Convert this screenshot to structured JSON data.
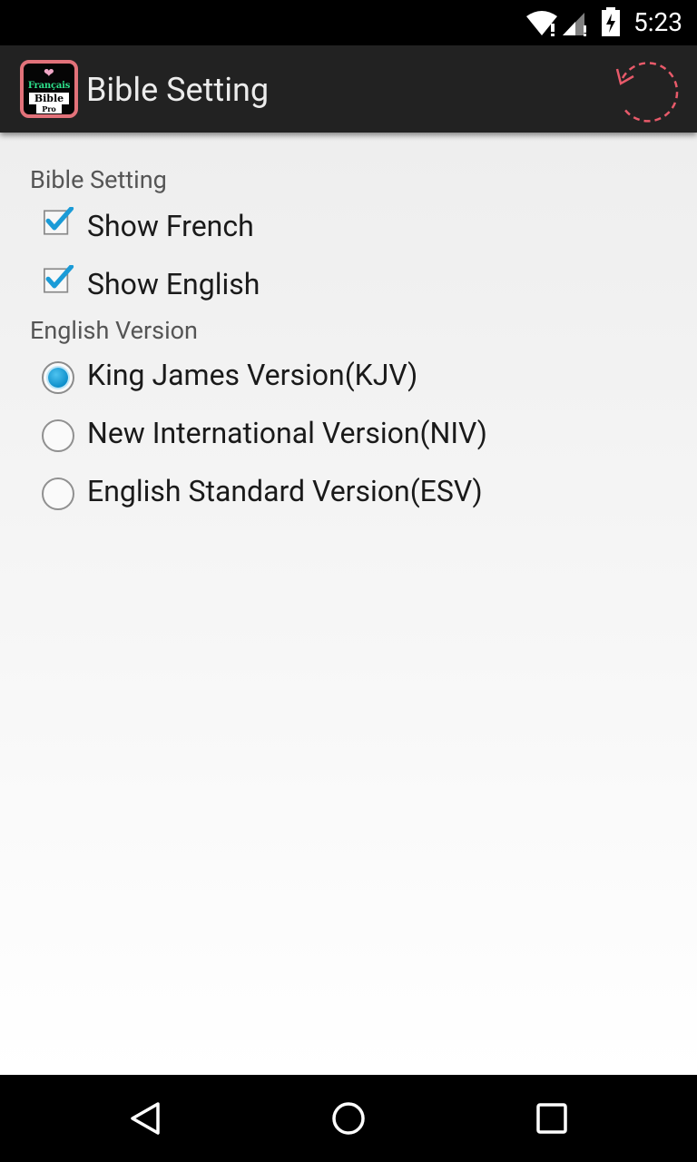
{
  "status_bar": {
    "time": "5:23"
  },
  "action_bar": {
    "title": "Bible Setting",
    "app_icon": {
      "line1": "Français",
      "line2": "Bible",
      "line3": "Pro"
    }
  },
  "sections": {
    "bible_setting": {
      "header": "Bible Setting",
      "show_french": {
        "label": "Show French",
        "checked": true
      },
      "show_english": {
        "label": "Show English",
        "checked": true
      }
    },
    "english_version": {
      "header": "English Version",
      "options": [
        {
          "label": "King James Version(KJV)",
          "selected": true
        },
        {
          "label": "New International Version(NIV)",
          "selected": false
        },
        {
          "label": "English Standard Version(ESV)",
          "selected": false
        }
      ]
    }
  },
  "colors": {
    "accent": "#1a9bd7",
    "action_bar": "#222222",
    "icon_border": "#e2727a"
  }
}
